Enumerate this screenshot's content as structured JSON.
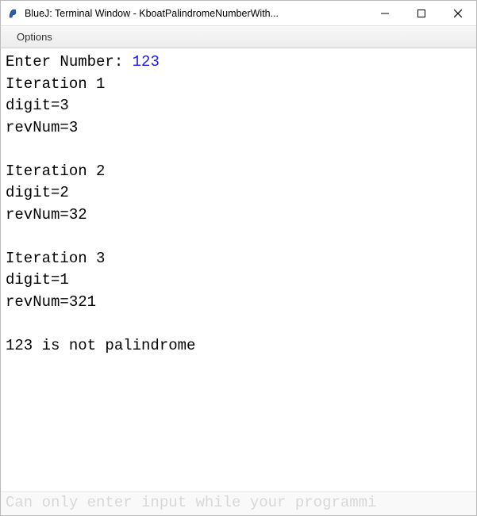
{
  "window": {
    "title": "BlueJ: Terminal Window - KboatPalindromeNumberWith..."
  },
  "menu": {
    "options": "Options"
  },
  "terminal": {
    "prompt": "Enter Number: ",
    "input": "123",
    "lines": [
      "Iteration 1",
      "digit=3",
      "revNum=3",
      "",
      "Iteration 2",
      "digit=2",
      "revNum=32",
      "",
      "Iteration 3",
      "digit=1",
      "revNum=321",
      "",
      "123 is not palindrome"
    ]
  },
  "status": {
    "text": "Can only enter input while your programmi"
  }
}
